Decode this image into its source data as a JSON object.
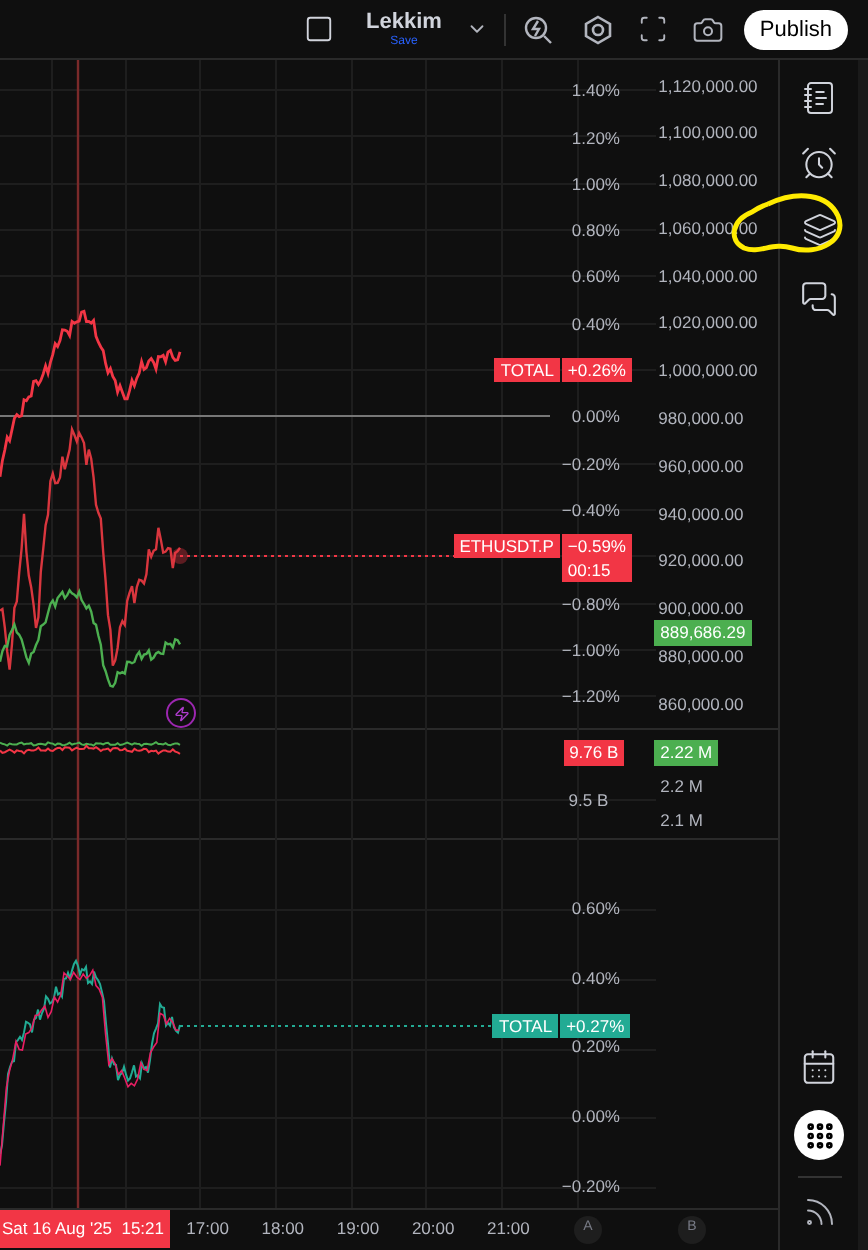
{
  "top_bar": {
    "layout_name": "Lekkim",
    "save_label": "Save",
    "publish_button": "Publish"
  },
  "price_pane": {
    "percent_axis": [
      {
        "kind": "tick",
        "label": "1.40%"
      },
      {
        "kind": "tick",
        "label": "1.20%"
      },
      {
        "kind": "tick",
        "label": "1.00%"
      },
      {
        "kind": "tick",
        "label": "0.80%"
      },
      {
        "kind": "tick",
        "label": "0.60%"
      },
      {
        "kind": "tick",
        "label": "0.40%"
      },
      {
        "kind": "badge",
        "name": "TOTAL",
        "value": "+0.26%",
        "color": "#f23645"
      },
      {
        "kind": "tick",
        "label": "0.00%"
      },
      {
        "kind": "tick",
        "label": "−0.20%"
      },
      {
        "kind": "tick",
        "label": "−0.40%"
      },
      {
        "kind": "badge",
        "name": "ETHUSDT.P",
        "value": "−0.59%",
        "countdown": "00:15",
        "color": "#f23645"
      },
      {
        "kind": "tick",
        "label": "−0.80%"
      },
      {
        "kind": "tick",
        "label": "−1.00%"
      },
      {
        "kind": "tick",
        "label": "−1.20%"
      }
    ],
    "value_axis": [
      "1,120,000.00",
      "1,100,000.00",
      "1,080,000.00",
      "1,060,000.00",
      "1,040,000.00",
      "1,020,000.00",
      "1,000,000.00",
      "980,000.00",
      "960,000.00",
      "940,000.00",
      "920,000.00",
      "900,000.00",
      "880,000.00",
      "860,000.00"
    ],
    "value_badge": {
      "label": "889,686.29",
      "color": "#4caf50"
    }
  },
  "volume_pane": {
    "percent_badge": {
      "label": "9.76 B",
      "color": "#f23645"
    },
    "percent_axis": [
      "9.5 B"
    ],
    "value_badge": {
      "label": "2.22 M",
      "color": "#4caf50"
    },
    "value_axis": [
      "2.2 M",
      "2.1 M"
    ]
  },
  "lower_pane": {
    "percent_axis": [
      "0.60%",
      "0.40%",
      "0.20%",
      "0.00%",
      "−0.20%"
    ],
    "badge": {
      "name": "TOTAL",
      "value": "+0.27%",
      "color": "#22ab94"
    }
  },
  "time_axis": {
    "cursor_date": "Sat 16 Aug '25",
    "cursor_time": "15:21",
    "ticks": [
      "17:00",
      "18:00",
      "19:00",
      "20:00",
      "21:00"
    ],
    "scale_buttons": [
      "A",
      "B"
    ]
  }
}
